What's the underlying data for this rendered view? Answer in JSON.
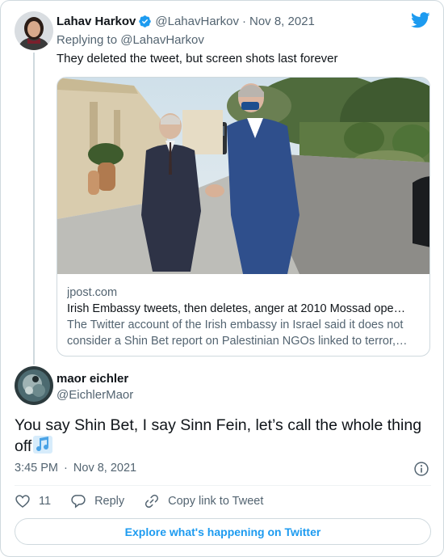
{
  "reply_tweet": {
    "author_name": "Lahav Harkov",
    "author_handle": "@LahavHarkov",
    "separator": "·",
    "date": "Nov 8, 2021",
    "replying_to_prefix": "Replying to ",
    "replying_to_handle": "@LahavHarkov",
    "text": "They deleted the tweet, but screen shots last forever",
    "link_card": {
      "domain": "jpost.com",
      "title": "Irish Embassy tweets, then deletes, anger at 2010 Mossad ope…",
      "description_line1": "The Twitter account of the Irish embassy in Israel said it does not",
      "description_line2": "consider a Shin Bet report on Palestinian NGOs linked to terror,…"
    }
  },
  "main_tweet": {
    "author_name": "maor eichler",
    "author_handle": "@EichlerMaor",
    "text": "You say Shin Bet, I say Sinn Fein, let’s call the whole thing off",
    "emoji_icon": "musical-notes-icon",
    "time": "3:45 PM",
    "separator": "·",
    "date": "Nov 8, 2021"
  },
  "actions": {
    "like_count": "11",
    "reply_label": "Reply",
    "copy_link_label": "Copy link to Tweet"
  },
  "footer": {
    "explore_label": "Explore what's happening on Twitter"
  },
  "colors": {
    "accent": "#1d9bf0",
    "text_primary": "#0f1419",
    "text_secondary": "#536471",
    "border": "#cfd9de"
  }
}
